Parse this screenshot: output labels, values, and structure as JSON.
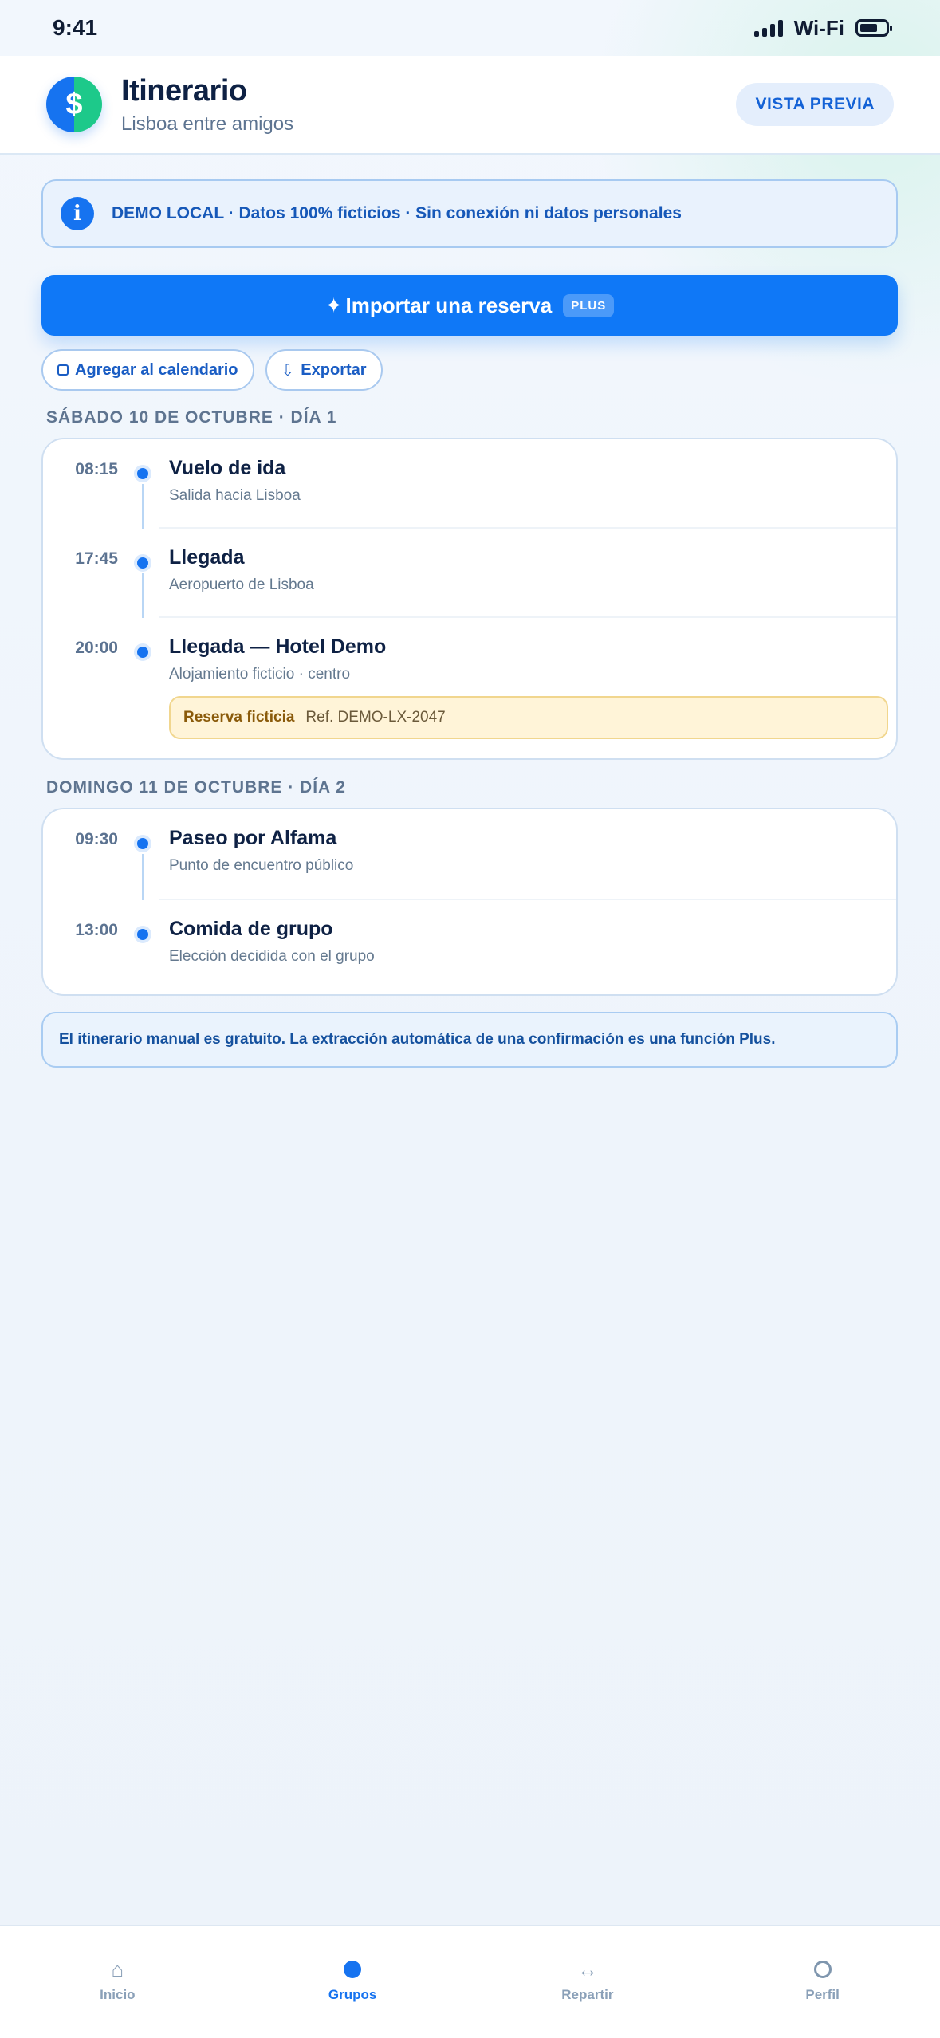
{
  "status_bar": {
    "time": "9:41",
    "wifi": "Wi-Fi"
  },
  "header": {
    "logo_symbol": "$",
    "title": "Itinerario",
    "subtitle": "Lisboa entre amigos",
    "preview_button": "VISTA PREVIA"
  },
  "demo_banner": {
    "icon": "i",
    "text": "DEMO LOCAL · Datos 100% ficticios · Sin conexión ni datos personales"
  },
  "import_button": {
    "icon": "✦",
    "label": "Importar una reserva",
    "badge": "PLUS"
  },
  "actions": {
    "calendar": "Agregar al calendario",
    "export_icon": "⇩",
    "export": "Exportar"
  },
  "days": [
    {
      "heading": "SÁBADO 10 DE OCTUBRE · DÍA 1",
      "events": [
        {
          "time": "08:15",
          "title": "Vuelo de ida",
          "subtitle": "Salida hacia Lisboa"
        },
        {
          "time": "17:45",
          "title": "Llegada",
          "subtitle": "Aeropuerto de Lisboa"
        },
        {
          "time": "20:00",
          "title": "Llegada — Hotel Demo",
          "subtitle": "Alojamiento ficticio · centro",
          "reservation": {
            "label": "Reserva ficticia",
            "reference": "Ref. DEMO-LX-2047"
          }
        }
      ]
    },
    {
      "heading": "DOMINGO 11 DE OCTUBRE · DÍA 2",
      "events": [
        {
          "time": "09:30",
          "title": "Paseo por Alfama",
          "subtitle": "Punto de encuentro público"
        },
        {
          "time": "13:00",
          "title": "Comida de grupo",
          "subtitle": "Elección decidida con el grupo"
        }
      ]
    }
  ],
  "note": "El itinerario manual es gratuito. La extracción automática de una confirmación es una función Plus.",
  "tab_bar": {
    "active": "Grupos",
    "tabs": [
      {
        "label": "Inicio",
        "icon": "home-icon",
        "glyph": "⌂"
      },
      {
        "label": "Grupos",
        "icon": "groups-icon",
        "glyph": ""
      },
      {
        "label": "Repartir",
        "icon": "split-icon",
        "glyph": "↔"
      },
      {
        "label": "Perfil",
        "icon": "profile-icon",
        "glyph": ""
      }
    ]
  },
  "colors": {
    "primary": "#0f78f7",
    "accent_green": "#1dc98a",
    "text_dark": "#0e2144",
    "reservation_bg": "#fff4d8"
  }
}
